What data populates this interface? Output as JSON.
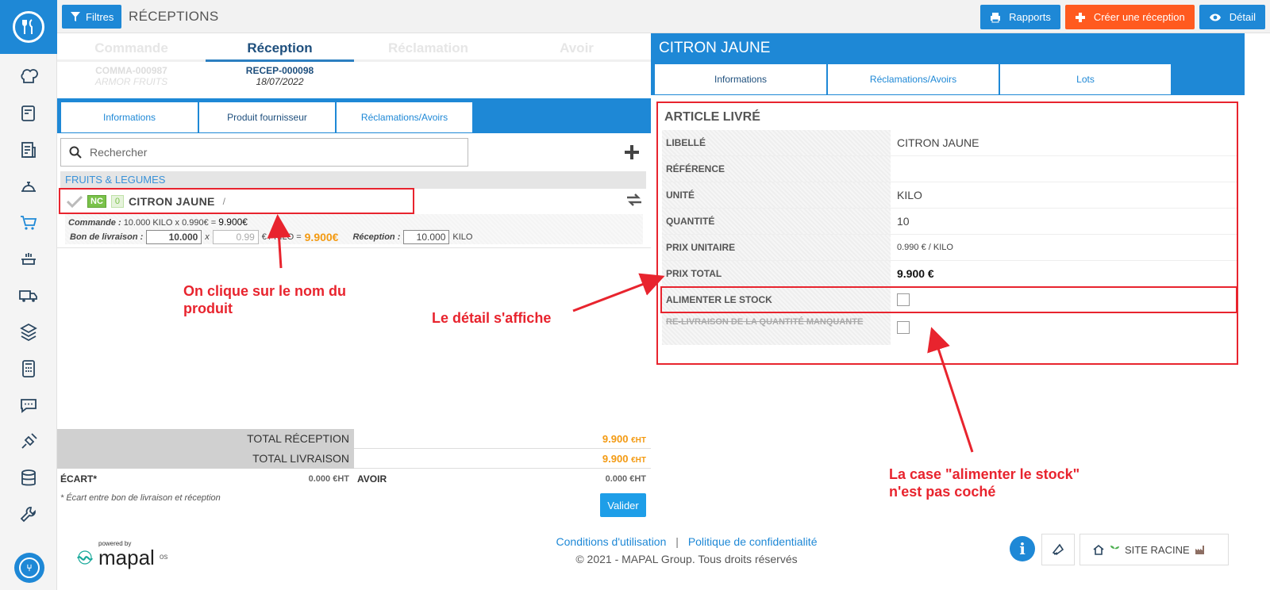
{
  "topbar": {
    "filter_label": "Filtres",
    "page_title": "RÉCEPTIONS",
    "buttons": {
      "rapports": "Rapports",
      "creer": "Créer une réception",
      "detail": "Détail"
    }
  },
  "steps": [
    {
      "name": "Commande",
      "ref": "COMMA-000987",
      "sub": "ARMOR FRUITS"
    },
    {
      "name": "Réception",
      "ref": "RECEP-000098",
      "sub": "18/07/2022"
    },
    {
      "name": "Réclamation",
      "ref": "",
      "sub": ""
    },
    {
      "name": "Avoir",
      "ref": "",
      "sub": ""
    }
  ],
  "left_tabs": [
    "Informations",
    "Produit fournisseur",
    "Réclamations/Avoirs"
  ],
  "search": {
    "placeholder": "Rechercher"
  },
  "category": "FRUITS & LEGUMES",
  "product": {
    "badge_nc": "NC",
    "badge_count": "0",
    "name": "CITRON JAUNE",
    "slash": "/",
    "commande_label": "Commande :",
    "commande_text": "10.000 KILO x  0.990€ =",
    "commande_total": "9.900€",
    "bon_label": "Bon de livraison :",
    "bon_qty": "10.000",
    "x": "x",
    "bon_price": "0.99",
    "unit_text": "€ / KILO =",
    "bon_total": "9.900€",
    "reception_label": "Réception :",
    "reception_qty": "10.000",
    "reception_unit": "KILO"
  },
  "totals": {
    "reception_label": "TOTAL RÉCEPTION",
    "reception_value": "9.900",
    "livraison_label": "TOTAL LIVRAISON",
    "livraison_value": "9.900",
    "currency": "€HT",
    "ecart_label": "ÉCART",
    "ecart_star": "*",
    "ecart_value": "0.000 €HT",
    "avoir_label": "AVOIR",
    "avoir_value": "0.000 €HT",
    "footnote": "Écart entre bon de livraison et réception",
    "footnote_star": "*",
    "valider": "Valider"
  },
  "right": {
    "title": "CITRON JAUNE",
    "tabs": [
      "Informations",
      "Réclamations/Avoirs",
      "Lots"
    ],
    "section_title": "ARTICLE LIVRÉ",
    "rows": [
      {
        "label": "LIBELLÉ",
        "value": "CITRON JAUNE"
      },
      {
        "label": "RÉFÉRENCE",
        "value": ""
      },
      {
        "label": "UNITÉ",
        "value": "KILO"
      },
      {
        "label": "QUANTITÉ",
        "value": "10"
      },
      {
        "label": "PRIX UNITAIRE",
        "value": "0.990 € / KILO"
      },
      {
        "label": "PRIX TOTAL",
        "value": "9.900 €"
      },
      {
        "label": "ALIMENTER LE STOCK",
        "value": ""
      },
      {
        "label": "RE-LIVRAISON DE LA QUANTITÉ MANQUANTE",
        "value": ""
      }
    ]
  },
  "annotations": {
    "click_name_1": "On clique sur le nom du",
    "click_name_2": "produit",
    "detail_shown": "Le détail s'affiche",
    "stock_1": "La case \"alimenter le stock\"",
    "stock_2": "n'est pas coché"
  },
  "footer": {
    "powered": "powered by",
    "brand": "mapal",
    "brand_sup": "os",
    "conditions": "Conditions d'utilisation",
    "separator": "|",
    "politique": "Politique de confidentialité",
    "copyright": "© 2021 - MAPAL Group. Tous droits réservés",
    "site": "SITE RACINE"
  },
  "colors": {
    "primary": "#1e88d6",
    "accent": "#ff5a1f",
    "price": "#f39a12",
    "annotation": "#e8242e"
  },
  "icons": [
    "filter-icon",
    "print-icon",
    "plus-icon",
    "eye-icon",
    "search-icon",
    "check-icon",
    "swap-icon",
    "info-icon",
    "bell-icon",
    "home-icon",
    "sprout-icon",
    "factory-icon"
  ]
}
